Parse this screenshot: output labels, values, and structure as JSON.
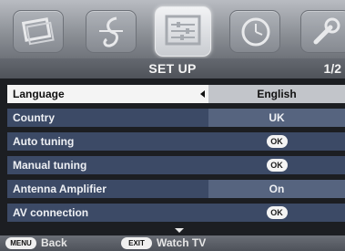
{
  "menu_tabs": [
    {
      "icon": "picture-icon"
    },
    {
      "icon": "sound-icon"
    },
    {
      "icon": "setup-icon",
      "active": true
    },
    {
      "icon": "clock-icon"
    },
    {
      "icon": "wrench-icon"
    }
  ],
  "header": {
    "title": "SET UP",
    "page": "1/2"
  },
  "rows": [
    {
      "label": "Language",
      "value": "English"
    },
    {
      "label": "Country",
      "value": "UK"
    },
    {
      "label": "Auto tuning",
      "value": "OK"
    },
    {
      "label": "Manual tuning",
      "value": "OK"
    },
    {
      "label": "Antenna Amplifier",
      "value": "On"
    },
    {
      "label": "AV connection",
      "value": "OK"
    }
  ],
  "footer": {
    "menu_key": "MENU",
    "back_label": "Back",
    "exit_key": "EXIT",
    "watch_label": "Watch TV"
  }
}
